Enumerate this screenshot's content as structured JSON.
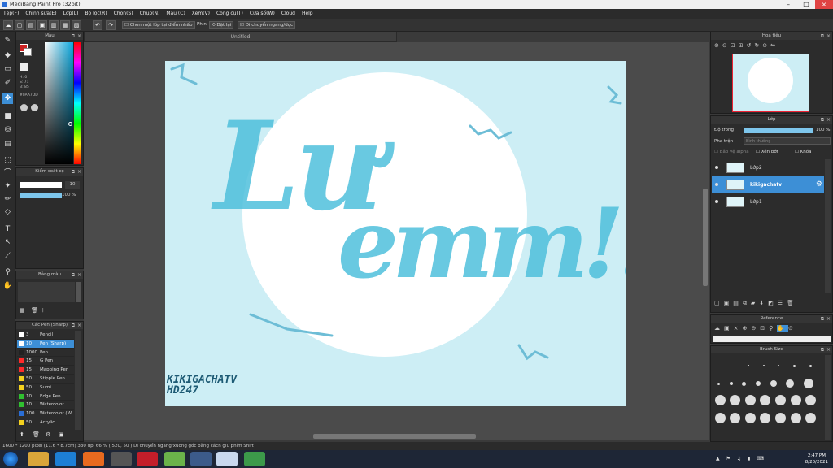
{
  "app": {
    "title": "MediBang Paint Pro (32bit)"
  },
  "menu": [
    "Tệp(F)",
    "Chỉnh sửa(E)",
    "Lớp(L)",
    "Bộ lọc(R)",
    "Chọn(S)",
    "Chụp(N)",
    "Màu (C)",
    "Xem(V)",
    "Công cụ(T)",
    "Cửa sổ(W)",
    "Cloud",
    "Help"
  ],
  "toolbar": {
    "select_from_layer": "Chọn một lớp tại điểm nhấp",
    "snap_label": "Phin",
    "snap_value": "Đặt lại",
    "move_mode": "Di chuyển ngang/dọc"
  },
  "document": {
    "tab": "Untitled"
  },
  "panels": {
    "color": {
      "title": "Màu",
      "h": "H: 0",
      "s": "S: 71",
      "v": "B: 85",
      "hex": "#0AA7DD"
    },
    "brush_control": {
      "title": "Kiểm soát cọ",
      "size": "10",
      "opacity": "100 %"
    },
    "palette": {
      "title": "Bảng màu",
      "value": "| ---"
    },
    "pens": {
      "title": "Các Pen (Sharp)",
      "items": [
        {
          "size": "3",
          "name": "Pencil",
          "color": "#ffffff"
        },
        {
          "size": "10",
          "name": "Pen (Sharp)",
          "color": "#ffffff",
          "selected": true
        },
        {
          "size": "1000",
          "name": "Pen",
          "color": "#222222"
        },
        {
          "size": "15",
          "name": "G Pen",
          "color": "#ff2a2a"
        },
        {
          "size": "15",
          "name": "Mapping Pen",
          "color": "#ff2a2a"
        },
        {
          "size": "50",
          "name": "Stipple Pen",
          "color": "#f4d11e"
        },
        {
          "size": "50",
          "name": "Sumi",
          "color": "#f4d11e"
        },
        {
          "size": "10",
          "name": "Edge Pen",
          "color": "#30c030"
        },
        {
          "size": "10",
          "name": "Watercolor",
          "color": "#30c030"
        },
        {
          "size": "100",
          "name": "Watercolor (W",
          "color": "#2a6ed6"
        },
        {
          "size": "50",
          "name": "Acrylic",
          "color": "#f4d11e"
        }
      ]
    },
    "navigator": {
      "title": "Hoa tiêu"
    },
    "layers": {
      "title": "Lớp",
      "opacity_label": "Độ trong",
      "opacity_value": "100 %",
      "blend_label": "Pha trộn",
      "blend_value": "Bình thường",
      "protect_alpha": "Bảo vệ alpha",
      "clipping": "Xén bớt",
      "lock": "Khóa",
      "items": [
        {
          "name": "Lớp2",
          "selected": false
        },
        {
          "name": "kikigachatv",
          "selected": true
        },
        {
          "name": "Lớp1",
          "selected": false
        }
      ]
    },
    "reference": {
      "title": "Reference"
    },
    "brush_size": {
      "title": "Brush Size",
      "rows": [
        [
          "0.7",
          "1",
          "1.5",
          "2",
          "3",
          "4",
          "5"
        ],
        [
          "7",
          "10",
          "12",
          "15",
          "20",
          "25",
          "30"
        ],
        [
          "40",
          "50",
          "70",
          "100",
          "150",
          "200",
          "250"
        ],
        [
          "300",
          "400",
          "500",
          "700",
          "1000",
          "1500",
          "2000"
        ]
      ]
    }
  },
  "artwork": {
    "text": "Lưu emmm!!!!",
    "signature_line1": "KIKIGACHATV",
    "signature_line2": "HD247"
  },
  "status": {
    "text": "1600 * 1200 pixel   (11.6 * 8.7cm)   330 dpi   66 %   ( 520, 50 )   Di chuyển ngang/xuống gốc bằng cách giữ phím Shift"
  },
  "taskbar": {
    "time": "2:47 PM",
    "date": "8/20/2021"
  },
  "colors": {
    "accent": "#3d8fd6",
    "ink": "#4fc0dc",
    "paper": "#cdeef5"
  }
}
